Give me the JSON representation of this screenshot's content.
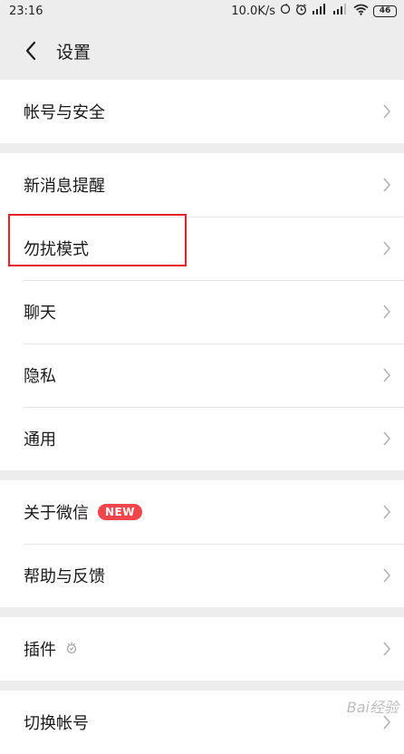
{
  "status": {
    "time": "23:16",
    "speed": "10.0K/s",
    "battery": "46"
  },
  "header": {
    "title": "设置"
  },
  "groups": [
    {
      "items": [
        {
          "label": "帐号与安全"
        }
      ]
    },
    {
      "items": [
        {
          "label": "新消息提醒"
        },
        {
          "label": "勿扰模式"
        },
        {
          "label": "聊天"
        },
        {
          "label": "隐私"
        },
        {
          "label": "通用"
        }
      ]
    },
    {
      "items": [
        {
          "label": "关于微信",
          "badge": "NEW"
        },
        {
          "label": "帮助与反馈"
        }
      ]
    },
    {
      "items": [
        {
          "label": "插件"
        }
      ]
    },
    {
      "items": [
        {
          "label": "切换帐号"
        }
      ]
    }
  ],
  "colors": {
    "badge": "#f0454b",
    "highlight": "#e8202a"
  },
  "watermark": "Bai经验"
}
